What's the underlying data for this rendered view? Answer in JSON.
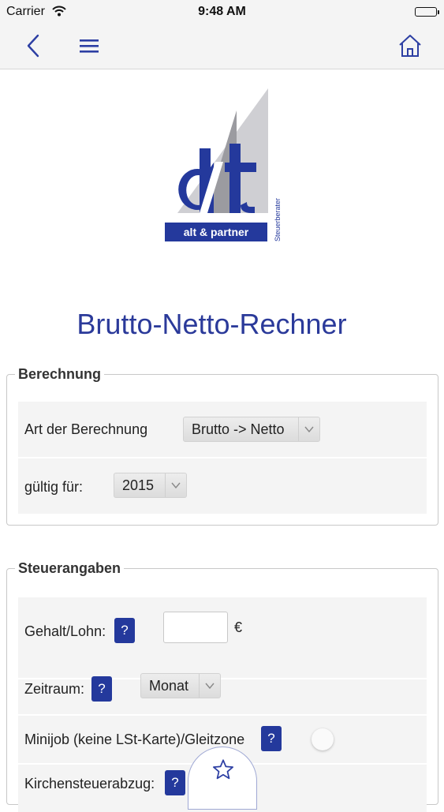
{
  "status_bar": {
    "carrier": "Carrier",
    "time": "9:48 AM"
  },
  "nav": {
    "back_icon": "chevron-left-icon",
    "menu_icon": "hamburger-menu-icon",
    "home_icon": "home-icon"
  },
  "logo": {
    "brand": "alt & partner",
    "tagline": "Steuerberater"
  },
  "page_title": "Brutto-Netto-Rechner",
  "berechnung": {
    "legend": "Berechnung",
    "art_label": "Art der Berechnung",
    "art_value": "Brutto -> Netto",
    "gueltig_label": "gültig für:",
    "gueltig_value": "2015"
  },
  "steuerangaben": {
    "legend": "Steuerangaben",
    "gehalt_label": "Gehalt/Lohn:",
    "gehalt_value": "",
    "currency": "€",
    "zeitraum_label": "Zeitraum:",
    "zeitraum_value": "Monat",
    "minijob_label": "Minijob (keine LSt-Karte)/Gleitzone",
    "kirchensteuer_label": "Kirchensteuerabzug:",
    "help_label": "?"
  },
  "favorite_icon": "star-icon",
  "colors": {
    "brand_blue": "#24399c",
    "title_blue": "#2b3a9a",
    "icon_blue": "#2d3fa3"
  }
}
